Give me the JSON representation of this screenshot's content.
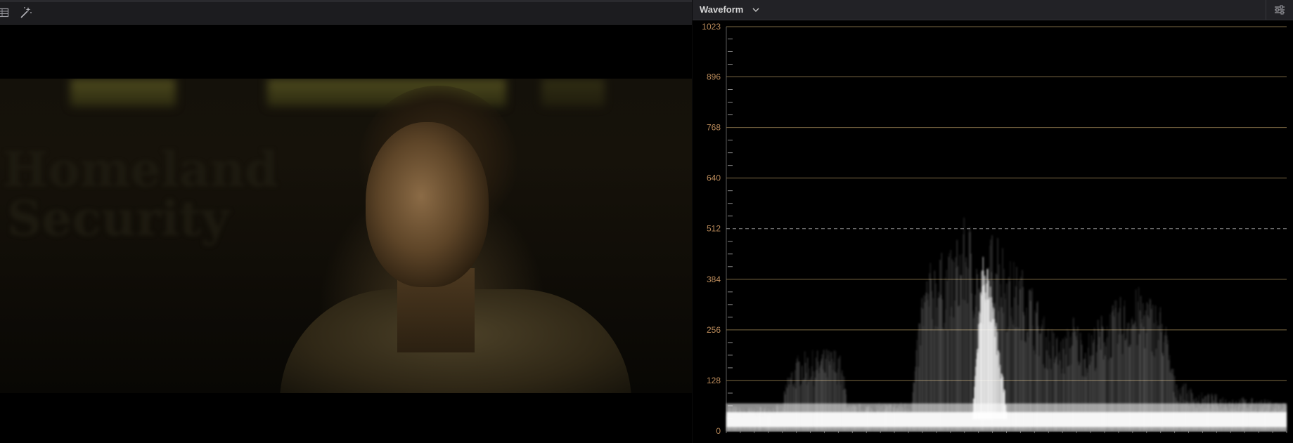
{
  "viewer": {
    "toolbar_icons": [
      "viewer-layout-icon",
      "magic-wand-icon"
    ],
    "background_text_lines": [
      "Homeland",
      "Security"
    ]
  },
  "scope": {
    "title": "Waveform",
    "dropdown_icon": "chevron-down-icon",
    "settings_icon": "sliders-icon"
  },
  "chart_data": {
    "type": "area",
    "title": "",
    "xlabel": "",
    "ylabel": "",
    "ylim": [
      0,
      1023
    ],
    "yticks": [
      0,
      128,
      256,
      384,
      512,
      640,
      768,
      896,
      1023
    ],
    "y_tick_labels": [
      "0",
      "128",
      "256",
      "384",
      "512",
      "640",
      "768",
      "896",
      "1023"
    ],
    "dashed_reference_line": 512,
    "grid": true,
    "x_domain": [
      0,
      1
    ],
    "series": [
      {
        "envelope_x": [
          0,
          0.03,
          0.1,
          0.11,
          0.13,
          0.2,
          0.22,
          0.33,
          0.35,
          0.37,
          0.4,
          0.43,
          0.46,
          0.48,
          0.5,
          0.54,
          0.57,
          0.6,
          0.62,
          0.64,
          0.67,
          0.7,
          0.74,
          0.78,
          0.8,
          0.84,
          0.9,
          1
        ],
        "envelope_y": [
          70,
          60,
          70,
          150,
          200,
          215,
          70,
          75,
          380,
          450,
          460,
          560,
          400,
          560,
          450,
          400,
          280,
          240,
          300,
          240,
          300,
          340,
          370,
          320,
          140,
          100,
          90,
          75
        ],
        "core_x": [
          0.44,
          0.45,
          0.46,
          0.47,
          0.48,
          0.49,
          0.5
        ],
        "core_y": [
          60,
          300,
          500,
          380,
          300,
          180,
          70
        ]
      }
    ]
  },
  "colors": {
    "panel_header": "#222226",
    "grid_solid": "#7d6a44",
    "tick_label": "#b98a5a",
    "trace": "#ffffff"
  }
}
